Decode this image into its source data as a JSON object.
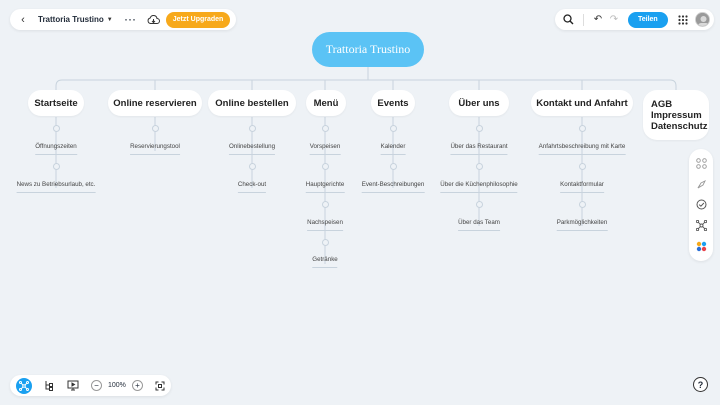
{
  "topbar": {
    "title": "Trattoria Trustino",
    "upgrade_label": "Jetzt Upgraden",
    "share_label": "Teilen"
  },
  "map": {
    "root": "Trattoria Trustino",
    "branches": [
      {
        "label": "Startseite",
        "children": [
          "Öffnungszeiten",
          "News zu Betriebsurlaub, etc."
        ]
      },
      {
        "label": "Online reservieren",
        "children": [
          "Reservierungstool"
        ]
      },
      {
        "label": "Online bestellen",
        "children": [
          "Onlinebestellung",
          "Check-out"
        ]
      },
      {
        "label": "Menü",
        "children": [
          "Vorspeisen",
          "Hauptgerichte",
          "Nachspeisen",
          "Getränke"
        ]
      },
      {
        "label": "Events",
        "children": [
          "Kalender",
          "Event-Beschreibungen"
        ]
      },
      {
        "label": "Über uns",
        "children": [
          "Über das Restaurant",
          "Über die Küchenphilosophie",
          "Über das Team"
        ]
      },
      {
        "label": "Kontakt und Anfahrt",
        "children": [
          "Anfahrtsbeschreibung mit Karte",
          "Kontaktformular",
          "Parkmöglichkeiten"
        ]
      },
      {
        "label": "AGB\nImpressum\nDatenschutz",
        "children": []
      }
    ]
  },
  "bottombar": {
    "zoom": "100%"
  },
  "icons": {
    "back": "chevron-left-icon",
    "menu_caret": "chevron-down-icon",
    "more": "more-horizontal-icon",
    "cloud": "cloud-sync-icon",
    "search": "search-icon",
    "undo": "undo-icon",
    "redo": "redo-icon",
    "apps": "grid-icon",
    "help": "help-icon"
  },
  "colors": {
    "accent": "#1aa0f0",
    "root": "#5bc3f5",
    "upgrade": "#f7a91b",
    "background": "#eef2f6"
  }
}
